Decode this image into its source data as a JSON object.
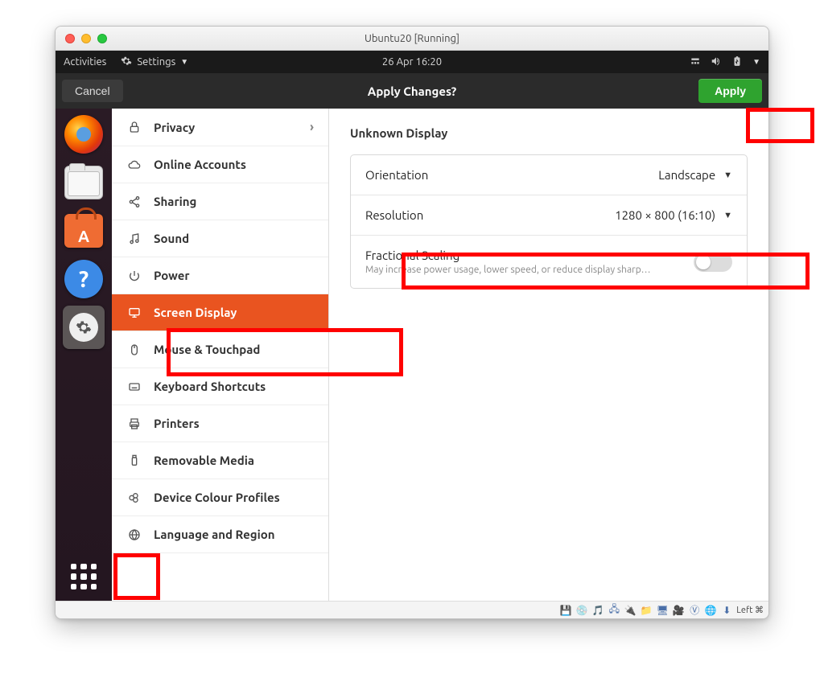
{
  "window": {
    "title": "Ubuntu20 [Running]"
  },
  "gnome": {
    "activities": "Activities",
    "settings_label": "Settings",
    "clock": "26 Apr  16:20"
  },
  "apply_bar": {
    "cancel": "Cancel",
    "title": "Apply Changes?",
    "apply": "Apply"
  },
  "sidebar": {
    "items": [
      {
        "icon": "lock",
        "label": "Privacy",
        "chev": true
      },
      {
        "icon": "cloud",
        "label": "Online Accounts"
      },
      {
        "icon": "share",
        "label": "Sharing"
      },
      {
        "icon": "note",
        "label": "Sound"
      },
      {
        "icon": "power",
        "label": "Power"
      },
      {
        "icon": "display",
        "label": "Screen Display",
        "selected": true
      },
      {
        "icon": "mouse",
        "label": "Mouse & Touchpad"
      },
      {
        "icon": "keyboard",
        "label": "Keyboard Shortcuts"
      },
      {
        "icon": "printer",
        "label": "Printers"
      },
      {
        "icon": "usb",
        "label": "Removable Media"
      },
      {
        "icon": "swatch",
        "label": "Device Colour Profiles"
      },
      {
        "icon": "globe",
        "label": "Language and Region"
      }
    ]
  },
  "content": {
    "section_title": "Unknown Display",
    "orientation": {
      "label": "Orientation",
      "value": "Landscape"
    },
    "resolution": {
      "label": "Resolution",
      "value": "1280 × 800 (16:10)"
    },
    "fractional": {
      "label": "Fractional Scaling",
      "sub": "May increase power usage, lower speed, or reduce display sharp…"
    }
  },
  "vm_status": {
    "text": "Left ⌘"
  }
}
